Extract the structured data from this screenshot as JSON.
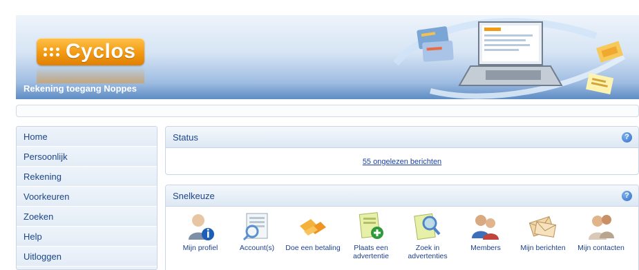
{
  "banner": {
    "logo_text": "Cyclos",
    "subtitle": "Rekening toegang Noppes"
  },
  "menu": {
    "items": [
      {
        "label": "Home"
      },
      {
        "label": "Persoonlijk"
      },
      {
        "label": "Rekening"
      },
      {
        "label": "Voorkeuren"
      },
      {
        "label": "Zoeken"
      },
      {
        "label": "Help"
      },
      {
        "label": "Uitloggen"
      }
    ]
  },
  "status": {
    "title": "Status",
    "help": "?",
    "message": "55 ongelezen berichten"
  },
  "quick": {
    "title": "Snelkeuze",
    "help": "?",
    "items": [
      {
        "icon": "user-profile-icon",
        "label": "Mijn profiel"
      },
      {
        "icon": "account-ledger-icon",
        "label": "Account(s)"
      },
      {
        "icon": "payment-cards-icon",
        "label": "Doe een betaling"
      },
      {
        "icon": "add-ad-icon",
        "label": "Plaats een advertentie"
      },
      {
        "icon": "search-ads-icon",
        "label": "Zoek in advertenties"
      },
      {
        "icon": "members-icon",
        "label": "Members"
      },
      {
        "icon": "messages-icon",
        "label": "Mijn berichten"
      },
      {
        "icon": "contacts-icon",
        "label": "Mijn contacten"
      }
    ]
  },
  "colors": {
    "accent": "#1c4589",
    "logo_orange": "#f29a12",
    "banner_blue": "#5d8cc4"
  }
}
